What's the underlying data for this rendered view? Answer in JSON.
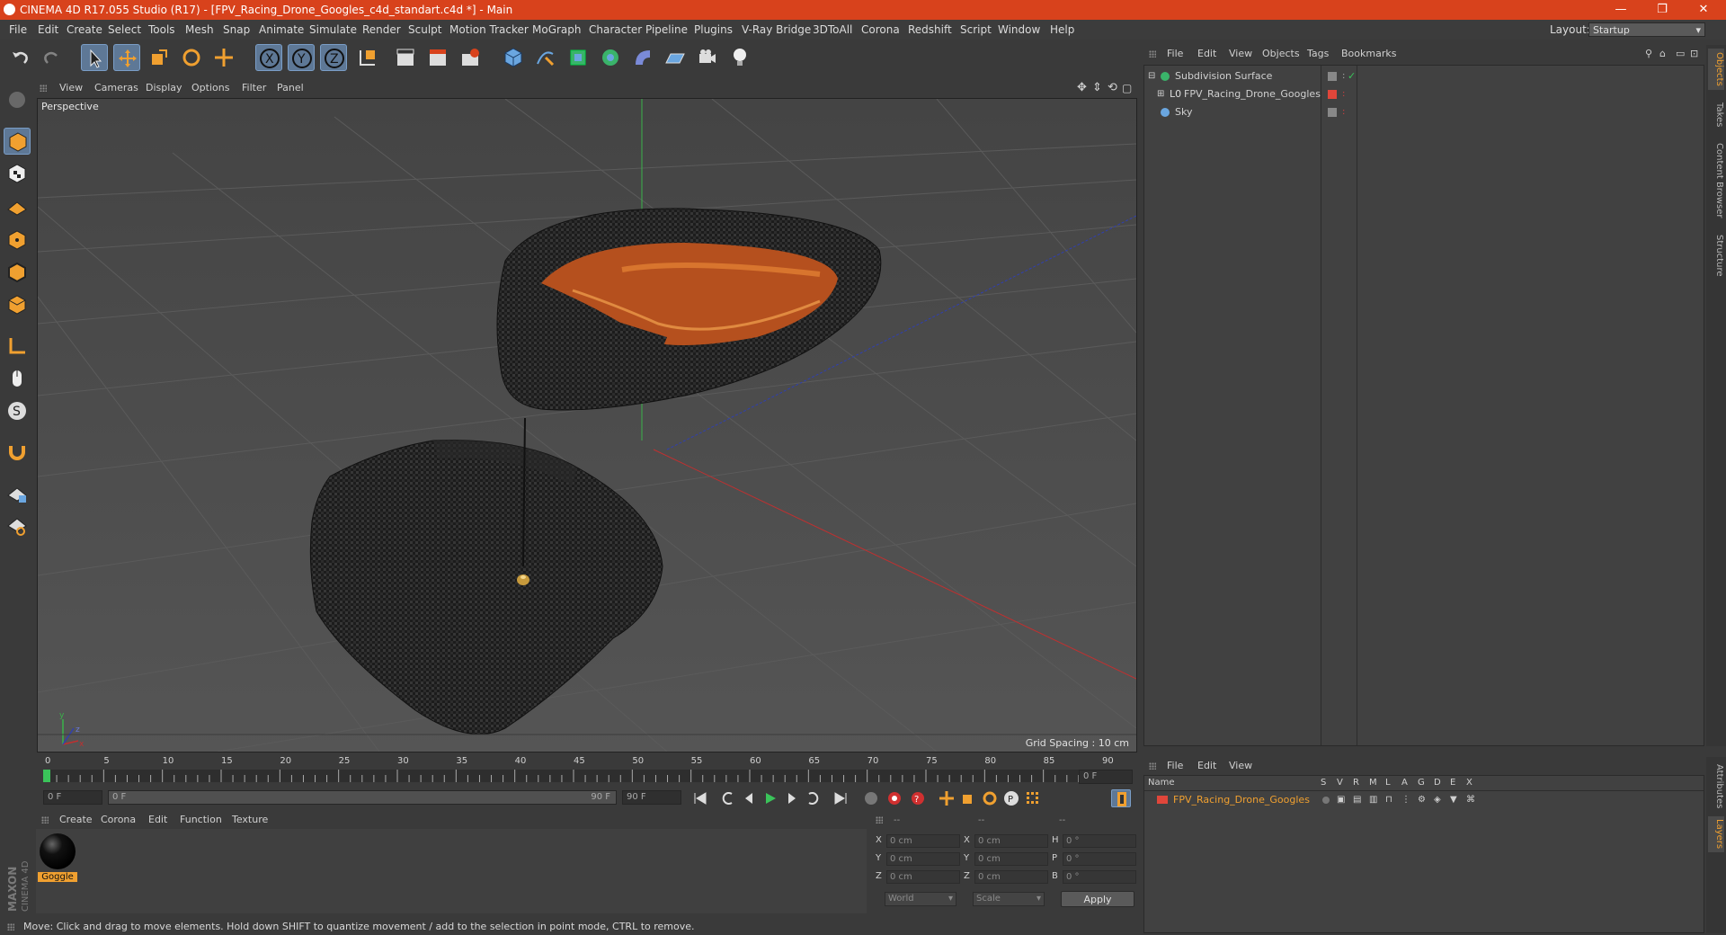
{
  "window": {
    "title": "CINEMA 4D R17.055 Studio (R17) - [FPV_Racing_Drone_Googles_c4d_standart.c4d *] - Main",
    "controls": [
      "—",
      "❐",
      "✕"
    ]
  },
  "menu": [
    "File",
    "Edit",
    "Create",
    "Select",
    "Tools",
    "Mesh",
    "Snap",
    "Animate",
    "Simulate",
    "Render",
    "Sculpt",
    "Motion Tracker",
    "MoGraph",
    "Character",
    "Pipeline",
    "Plugins",
    "V-Ray Bridge",
    "3DToAll",
    "Corona",
    "Redshift",
    "Script",
    "Window",
    "Help"
  ],
  "layout": {
    "label": "Layout:",
    "value": "Startup"
  },
  "viewport": {
    "menu": [
      "View",
      "Cameras",
      "Display",
      "Options",
      "Filter",
      "Panel"
    ],
    "label": "Perspective",
    "grid_spacing": "Grid Spacing : 10 cm"
  },
  "timeline": {
    "ticks": [
      "0",
      "5",
      "10",
      "15",
      "20",
      "25",
      "30",
      "35",
      "40",
      "45",
      "50",
      "55",
      "60",
      "65",
      "70",
      "75",
      "80",
      "85",
      "90"
    ],
    "current_frame": "0 F",
    "start_field": "0 F",
    "range_start": "0 F",
    "range_end": "90 F",
    "end_field": "90 F"
  },
  "material_manager": {
    "menu": [
      "Create",
      "Corona",
      "Edit",
      "Function",
      "Texture"
    ],
    "material_name": "Goggle"
  },
  "coordinates": {
    "headers": [
      "--",
      "--",
      "--"
    ],
    "rows": [
      {
        "a": "X",
        "av": "0 cm",
        "b": "X",
        "bv": "0 cm",
        "c": "H",
        "cv": "0 °"
      },
      {
        "a": "Y",
        "av": "0 cm",
        "b": "Y",
        "bv": "0 cm",
        "c": "P",
        "cv": "0 °"
      },
      {
        "a": "Z",
        "av": "0 cm",
        "b": "Z",
        "bv": "0 cm",
        "c": "B",
        "cv": "0 °"
      }
    ],
    "mode1": "World",
    "mode2": "Scale",
    "apply": "Apply"
  },
  "object_manager": {
    "menu": [
      "File",
      "Edit",
      "View",
      "Objects",
      "Tags",
      "Bookmarks"
    ],
    "objects": [
      {
        "name": "Subdivision Surface"
      },
      {
        "name": "FPV_Racing_Drone_Googles"
      },
      {
        "name": "Sky"
      }
    ]
  },
  "layer_manager": {
    "menu": [
      "File",
      "Edit",
      "View"
    ],
    "columns": [
      "Name",
      "S",
      "V",
      "R",
      "M",
      "L",
      "A",
      "G",
      "D",
      "E",
      "X"
    ],
    "layers": [
      {
        "name": "FPV_Racing_Drone_Googles"
      }
    ]
  },
  "side_tabs": {
    "top": [
      "Objects",
      "Takes",
      "Content Browser",
      "Structure"
    ],
    "bottom": [
      "Attributes",
      "Layers"
    ]
  },
  "status": "Move: Click and drag to move elements. Hold down SHIFT to quantize movement / add to the selection in point mode, CTRL to remove.",
  "brand": "MAXON CINEMA 4D",
  "colors": {
    "title_bar": "#d8421c",
    "selected_tool": "#5e7896",
    "layer_color": "#e0463a",
    "accent_orange": "#f0a030"
  }
}
